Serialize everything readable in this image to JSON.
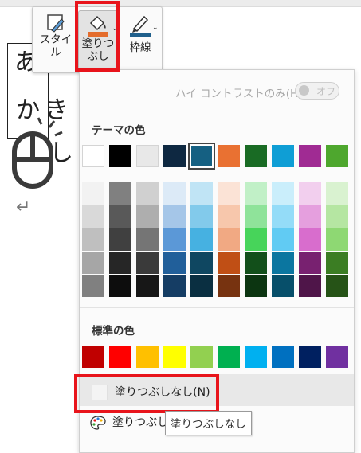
{
  "document": {
    "char1": "あ",
    "char2": "か",
    "char3": "き",
    "char4": "し",
    "return_mark": "↵"
  },
  "mini_toolbar": {
    "style_label": "スタイル",
    "fill_label": "塗りつぶし",
    "border_label": "枠線",
    "fill_color": "#e46c2c",
    "border_color": "#1f5f8b"
  },
  "panel": {
    "high_contrast_label": "ハイ コントラストのみ(H)",
    "toggle_label": "オフ",
    "theme_title": "テーマの色",
    "standard_title": "標準の色",
    "no_fill_label": "塗りつぶしなし(N)",
    "more_colors_label": "塗りつぶしの色",
    "theme_colors": [
      "#ffffff",
      "#000000",
      "#e8e8e8",
      "#0e2841",
      "#156082",
      "#e97132",
      "#196b24",
      "#0f9ed5",
      "#a02b93",
      "#4ea72e"
    ],
    "selected_theme_index": 4,
    "shades": [
      [
        "#f2f2f2",
        "#808080",
        "#d0d0d0",
        "#dceaf7",
        "#c0e4f5",
        "#fbe3d6",
        "#c1f0c7",
        "#caeefb",
        "#f2cfee",
        "#d9f2d0"
      ],
      [
        "#d9d9d9",
        "#595959",
        "#aeaeae",
        "#a5c6e8",
        "#82caeb",
        "#f7c7ac",
        "#8fe39a",
        "#94dcf8",
        "#e59fde",
        "#b5e6a2"
      ],
      [
        "#bfbfbf",
        "#404040",
        "#757575",
        "#5b98d7",
        "#46b1e1",
        "#f1a983",
        "#47d45a",
        "#61cbf3",
        "#d86dcd",
        "#8ed873"
      ],
      [
        "#a6a6a6",
        "#262626",
        "#3a3a3a",
        "#215f9a",
        "#0f4761",
        "#c04f15",
        "#124f1a",
        "#0b76a0",
        "#782170",
        "#3b7d23"
      ],
      [
        "#808080",
        "#0d0d0d",
        "#171717",
        "#153d64",
        "#0a2f41",
        "#773310",
        "#0c3511",
        "#074f6a",
        "#4f1549",
        "#265317"
      ]
    ],
    "standard_colors": [
      "#c00000",
      "#ff0000",
      "#ffc000",
      "#ffff00",
      "#92d050",
      "#00b050",
      "#00b0f0",
      "#0070c0",
      "#002060",
      "#7030a0"
    ]
  },
  "tooltip": {
    "text": "塗りつぶしなし"
  }
}
